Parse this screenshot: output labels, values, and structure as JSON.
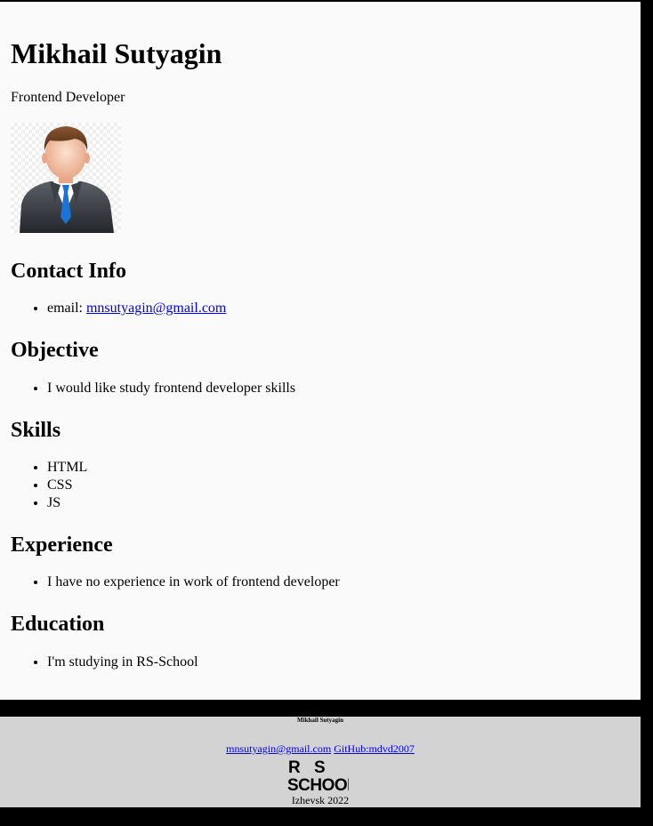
{
  "header": {
    "name": "Mikhail Sutyagin",
    "title": "Frontend Developer"
  },
  "avatar": {
    "icon": "businessman-avatar-icon"
  },
  "sections": {
    "contact": {
      "heading": "Contact Info",
      "email_label": "email:",
      "email": "mnsutyagin@gmail.com"
    },
    "objective": {
      "heading": "Objective",
      "items": [
        "I would like study frontend developer skills"
      ]
    },
    "skills": {
      "heading": "Skills",
      "items": [
        "HTML",
        "CSS",
        "JS"
      ]
    },
    "experience": {
      "heading": "Experience",
      "items": [
        "I have no experience in work of frontend developer"
      ]
    },
    "education": {
      "heading": "Education",
      "items": [
        "I'm studying in RS-School"
      ]
    }
  },
  "footer": {
    "name": "Mikhail Sutyagin",
    "email": "mnsutyagin@gmail.com",
    "github": "GitHub:mdvd2007",
    "logo_line1": "R S",
    "logo_line2": "SCHOOL",
    "city": "Izhevsk 2022"
  },
  "colors": {
    "page_bg": "#fafafa",
    "footer_bg": "#d3d3d3",
    "outer_bg": "#000000",
    "link": "#0000ee"
  }
}
